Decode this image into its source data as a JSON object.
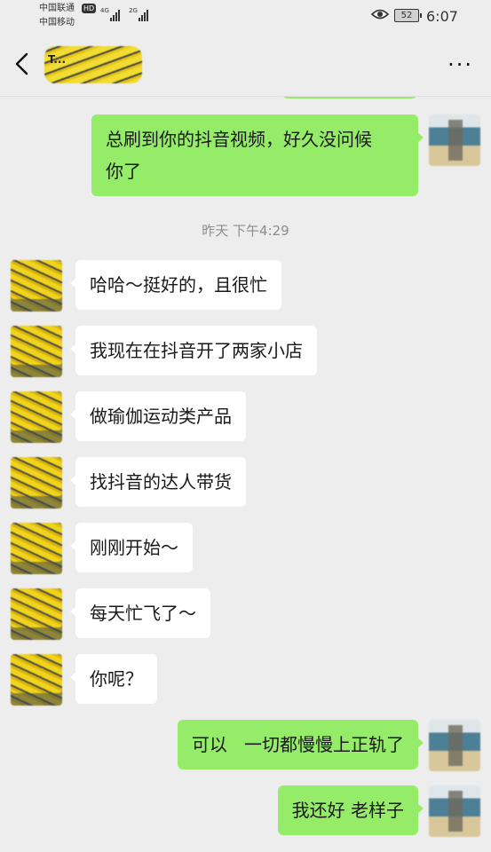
{
  "status_bar": {
    "carrier1": "中国联通",
    "carrier2": "中国移动",
    "hd": "HD",
    "net1": "4G",
    "net2": "2G",
    "battery": "52",
    "time": "6:07"
  },
  "header": {
    "title": "T...",
    "back_icon": "chevron-left-icon",
    "more_icon": "ellipsis-icon"
  },
  "messages": [
    {
      "side": "out",
      "text": "总刷到你的抖音视频，好久没问候\n你了"
    },
    {
      "type": "time",
      "text": "昨天 下午4:29"
    },
    {
      "side": "in",
      "text": "哈哈～挺好的，且很忙"
    },
    {
      "side": "in",
      "text": "我现在在抖音开了两家小店"
    },
    {
      "side": "in",
      "text": "做瑜伽运动类产品"
    },
    {
      "side": "in",
      "text": "找抖音的达人带货"
    },
    {
      "side": "in",
      "text": "刚刚开始～"
    },
    {
      "side": "in",
      "text": "每天忙飞了～"
    },
    {
      "side": "in",
      "text": "你呢？"
    },
    {
      "side": "out",
      "text": "可以   一切都慢慢上正轨了"
    },
    {
      "side": "out",
      "text": "我还好 老样子"
    }
  ],
  "colors": {
    "background": "#ededed",
    "bubble_out": "#95ec69",
    "bubble_in": "#ffffff",
    "timestamp": "#8d8d8d"
  }
}
